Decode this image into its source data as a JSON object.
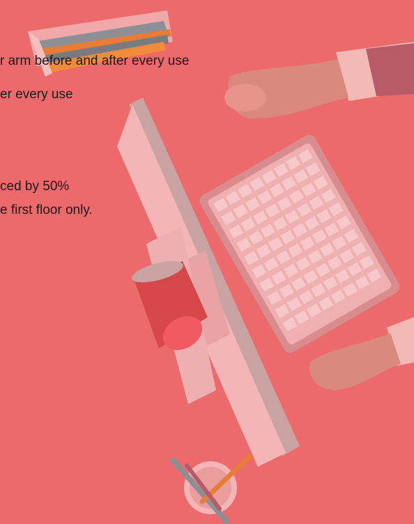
{
  "background_color": "#ec6a6b",
  "text_lines": [
    "r arm before and after every use",
    "er every use",
    "ced by 50%",
    "e first floor only."
  ],
  "illustration": {
    "objects": [
      "binders",
      "hand-top-right",
      "computer-monitor",
      "keyboard",
      "coffee-cup",
      "hand-bottom-right",
      "pencil-cup"
    ]
  }
}
